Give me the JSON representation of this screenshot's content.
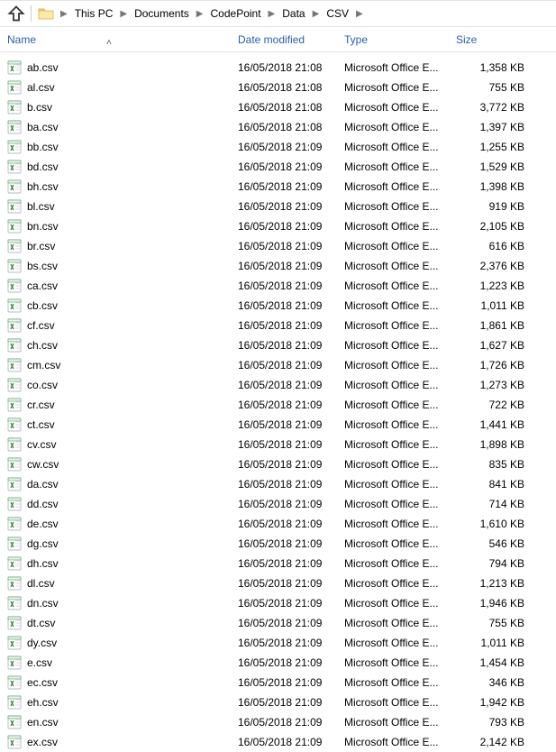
{
  "breadcrumb": [
    "This PC",
    "Documents",
    "CodePoint",
    "Data",
    "CSV"
  ],
  "columns": {
    "name": "Name",
    "date": "Date modified",
    "type": "Type",
    "size": "Size"
  },
  "file_type_label": "Microsoft Office E...",
  "files": [
    {
      "name": "ab.csv",
      "date": "16/05/2018 21:08",
      "size": "1,358 KB"
    },
    {
      "name": "al.csv",
      "date": "16/05/2018 21:08",
      "size": "755 KB"
    },
    {
      "name": "b.csv",
      "date": "16/05/2018 21:08",
      "size": "3,772 KB"
    },
    {
      "name": "ba.csv",
      "date": "16/05/2018 21:08",
      "size": "1,397 KB"
    },
    {
      "name": "bb.csv",
      "date": "16/05/2018 21:09",
      "size": "1,255 KB"
    },
    {
      "name": "bd.csv",
      "date": "16/05/2018 21:09",
      "size": "1,529 KB"
    },
    {
      "name": "bh.csv",
      "date": "16/05/2018 21:09",
      "size": "1,398 KB"
    },
    {
      "name": "bl.csv",
      "date": "16/05/2018 21:09",
      "size": "919 KB"
    },
    {
      "name": "bn.csv",
      "date": "16/05/2018 21:09",
      "size": "2,105 KB"
    },
    {
      "name": "br.csv",
      "date": "16/05/2018 21:09",
      "size": "616 KB"
    },
    {
      "name": "bs.csv",
      "date": "16/05/2018 21:09",
      "size": "2,376 KB"
    },
    {
      "name": "ca.csv",
      "date": "16/05/2018 21:09",
      "size": "1,223 KB"
    },
    {
      "name": "cb.csv",
      "date": "16/05/2018 21:09",
      "size": "1,011 KB"
    },
    {
      "name": "cf.csv",
      "date": "16/05/2018 21:09",
      "size": "1,861 KB"
    },
    {
      "name": "ch.csv",
      "date": "16/05/2018 21:09",
      "size": "1,627 KB"
    },
    {
      "name": "cm.csv",
      "date": "16/05/2018 21:09",
      "size": "1,726 KB"
    },
    {
      "name": "co.csv",
      "date": "16/05/2018 21:09",
      "size": "1,273 KB"
    },
    {
      "name": "cr.csv",
      "date": "16/05/2018 21:09",
      "size": "722 KB"
    },
    {
      "name": "ct.csv",
      "date": "16/05/2018 21:09",
      "size": "1,441 KB"
    },
    {
      "name": "cv.csv",
      "date": "16/05/2018 21:09",
      "size": "1,898 KB"
    },
    {
      "name": "cw.csv",
      "date": "16/05/2018 21:09",
      "size": "835 KB"
    },
    {
      "name": "da.csv",
      "date": "16/05/2018 21:09",
      "size": "841 KB"
    },
    {
      "name": "dd.csv",
      "date": "16/05/2018 21:09",
      "size": "714 KB"
    },
    {
      "name": "de.csv",
      "date": "16/05/2018 21:09",
      "size": "1,610 KB"
    },
    {
      "name": "dg.csv",
      "date": "16/05/2018 21:09",
      "size": "546 KB"
    },
    {
      "name": "dh.csv",
      "date": "16/05/2018 21:09",
      "size": "794 KB"
    },
    {
      "name": "dl.csv",
      "date": "16/05/2018 21:09",
      "size": "1,213 KB"
    },
    {
      "name": "dn.csv",
      "date": "16/05/2018 21:09",
      "size": "1,946 KB"
    },
    {
      "name": "dt.csv",
      "date": "16/05/2018 21:09",
      "size": "755 KB"
    },
    {
      "name": "dy.csv",
      "date": "16/05/2018 21:09",
      "size": "1,011 KB"
    },
    {
      "name": "e.csv",
      "date": "16/05/2018 21:09",
      "size": "1,454 KB"
    },
    {
      "name": "ec.csv",
      "date": "16/05/2018 21:09",
      "size": "346 KB"
    },
    {
      "name": "eh.csv",
      "date": "16/05/2018 21:09",
      "size": "1,942 KB"
    },
    {
      "name": "en.csv",
      "date": "16/05/2018 21:09",
      "size": "793 KB"
    },
    {
      "name": "ex.csv",
      "date": "16/05/2018 21:09",
      "size": "2,142 KB"
    }
  ]
}
